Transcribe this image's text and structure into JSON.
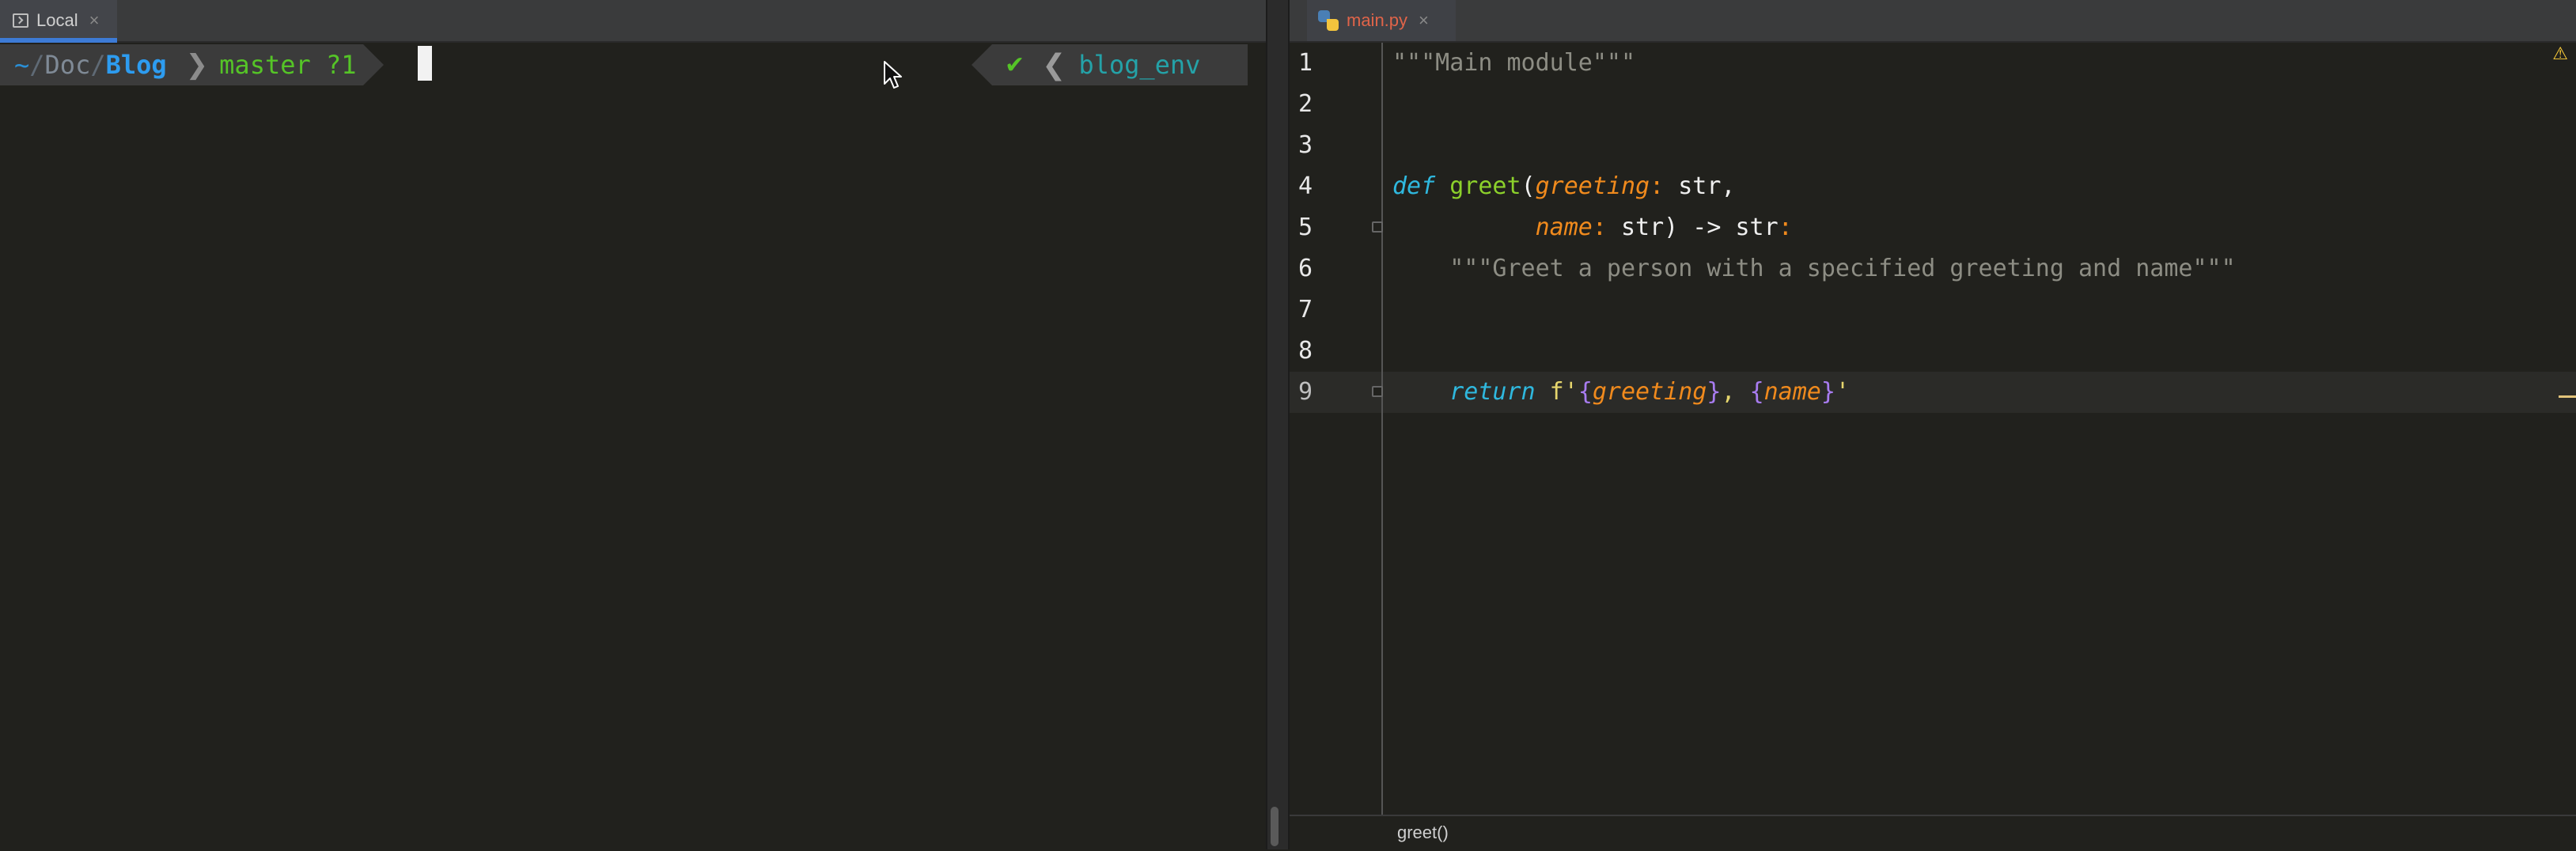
{
  "terminal": {
    "tab_label": "Local",
    "tab_close": "×",
    "prompt": {
      "tilde": "~",
      "sep1": "/",
      "dir1": "Doc",
      "sep2": "/",
      "dir2": "Blog",
      "chevron": "❯",
      "git": "master ?1",
      "check": "✔",
      "env_chevron": "❮",
      "env": "blog_env"
    }
  },
  "editor": {
    "tab_label": "main.py",
    "tab_close": "×",
    "breadcrumb": "greet()",
    "current_line": 9,
    "lines": [
      {
        "n": "1"
      },
      {
        "n": "2"
      },
      {
        "n": "3"
      },
      {
        "n": "4"
      },
      {
        "n": "5"
      },
      {
        "n": "6"
      },
      {
        "n": "7"
      },
      {
        "n": "8"
      },
      {
        "n": "9"
      }
    ],
    "code": {
      "l1_doc": "\"\"\"Main module\"\"\"",
      "l4_def": "def",
      "l4_name": "greet",
      "l4_paren": "(",
      "l4_param": "greeting",
      "l4_colon": ":",
      "l4_type": " str,",
      "l5_indent": "          ",
      "l5_param": "name",
      "l5_colon": ":",
      "l5_rest": " str) -> str",
      "l5_end_colon": ":",
      "l6_doc": "    \"\"\"Greet a person with a specified greeting and name\"\"\"",
      "l9_indent": "    ",
      "l9_return": "return",
      "l9_f": " f'",
      "l9_b1": "{",
      "l9_var1": "greeting",
      "l9_b2": "}",
      "l9_comma": ", ",
      "l9_b3": "{",
      "l9_var2": "name",
      "l9_b4": "}",
      "l9_q": "'"
    }
  },
  "icons": {
    "terminal": "terminal-icon",
    "python": "python-file-icon",
    "warning": "warning-icon",
    "pointer": "mouse-pointer-icon"
  },
  "colors": {
    "background": "#21211d",
    "accent": "#3d7bd6",
    "git": "#55c427",
    "keyword": "#2fb8de",
    "param": "#f08a1d",
    "function": "#8cd12b"
  }
}
